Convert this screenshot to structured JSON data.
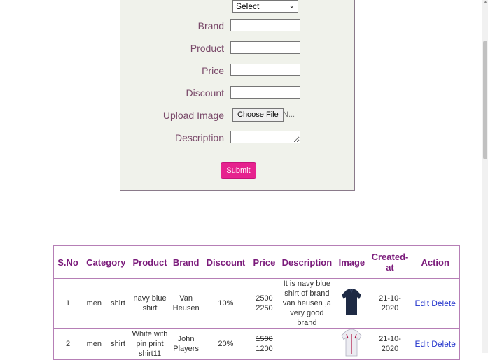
{
  "form": {
    "category_select": "Select",
    "fields": [
      {
        "label": "Brand",
        "value": ""
      },
      {
        "label": "Product",
        "value": ""
      },
      {
        "label": "Price",
        "value": ""
      },
      {
        "label": "Discount",
        "value": ""
      }
    ],
    "upload_label": "Upload Image",
    "file_button": "Choose File",
    "file_status": "N...",
    "description_label": "Description",
    "submit_label": "Submit"
  },
  "table": {
    "headers": [
      "S.No",
      "Category",
      "Product",
      "Brand",
      "Discount",
      "Price",
      "Description",
      "Image",
      "Created-at",
      "Action"
    ],
    "rows": [
      {
        "sno": "1",
        "category": "men",
        "subcategory": "shirt",
        "product": "navy blue shirt",
        "brand": "Van Heusen",
        "discount": "10%",
        "price_old": "2500",
        "price_new": "2250",
        "description": "It is navy blue shirt of brand van heusen ,a very good brand",
        "image": "navy-shirt-thumbnail",
        "image_color": "#1e2a44",
        "created": "21-10-2020",
        "edit": "Edit",
        "delete": "Delete"
      },
      {
        "sno": "2",
        "category": "men",
        "subcategory": "shirt",
        "product": "White with pin print shirt11",
        "brand": "John Players",
        "discount": "20%",
        "price_old": "1500",
        "price_new": "1200",
        "description": "",
        "image": "white-shirt-thumbnail",
        "image_color": "#e8e8ee",
        "created": "21-10-2020",
        "edit": "Edit",
        "delete": "Delete"
      }
    ]
  }
}
